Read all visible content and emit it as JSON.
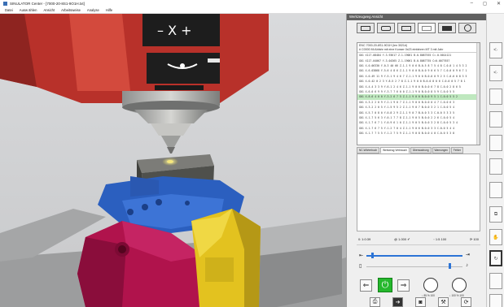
{
  "window": {
    "title": "SINULATOR Center - [7000-20-8S1-9O1H.txt]",
    "controls": [
      "–",
      "◻",
      "✕"
    ]
  },
  "menu": [
    "Datei",
    "Ausw ählen",
    "Ansicht",
    "Arbeitsweise",
    "Analyse",
    "Hilfe"
  ],
  "panel": {
    "header": "Werkzeugweg Ansicht",
    "toolbar_icons": [
      "pane-icon",
      "measure-icon",
      "stock-icon",
      "blank-icon",
      "machine-icon",
      "settings-icon"
    ],
    "nc_header": [
      "ENC 7000-20-8S1-9O1H (len 3021#)",
      "# C0000 Mi Abfahr mit eine Konser 0x23 einfahren MT 3 mit Jahr"
    ],
    "nc_lines": [
      "G01 X117.08484 Y-3.93617 Z-1.19061 B-0.8087555 C=-0.0014121",
      "G01 X117.04067 Y-3.04365 Z-1.19061 B-0.8087755 C=0.0077657",
      "G01 X-0.06330 Y-0.3 40 66 Z-1.1 9 0 6 B-0.5 8 7 5 4 8 C-0.0 1 4 5 3 2",
      "G01 X-6.03868 Y-5.6 4 8 6 Z-1.1 9 0 0 B-0.0 9 0 6 5 7 C-0.0 0 9 6 7 1",
      "G01 X-0.49 11 9 Y-5.1 9 4 6 7 Z-1.1 9 0 0 B-0.0 0 9 2 5 C-0.0 0 8 3 5",
      "G01 X-0.42 0 2 3 Y-8.5 2 7 8 Z-1.1 9 0 0 B-0.0 8 0 6 C-0.0 0 5 7 8 1",
      "G01 X-4.4 3 3 9 Y-6.1 2 4 6 Z-1.1 9 0 0 B-0.0 6 7 8 C-0.0 2 8 6 5",
      "G01 X-6.0 6 9 9 Y-3.7 7 6 0 0 Z-1.1 9 0 B-0.0 8 5 9 C-0.0 5 5",
      "G01 X-8.6 4 0 0 Y-3.2 6 7 5 Z-1.1 9 0 0 B-0.0 9 5 1 C-0.0 5 5 2",
      "G01 X-3.2 2 0 9 Y-2.1 9 0 7 Z-1.1 9 0 0 B-0.0 0 4 7 C-0.0 6 3",
      "G01 X-3.2 2 0 5 Y-1.5 9 5 2 Z-1.1 9 0 7 B-0.0 3 2 1 C-0.0 5 4",
      "G01 X-5.7 0 8 0 Y-0.8 2 9 Z-1.1 9 0 7 B-0.0 3 3 C-0.0 5 3 3 5",
      "G01 X-1.7 5 6 3 Y-0.1 7 7 8 Z-1.1 9 0 5 B-0.0 2 2 6 C-0.0 5 4",
      "G01 X-1.7 6 7 1 Y-0.9 6 1 0 Z-1.1 9 0 5 B-0.0 3 2 8 C-0.0 5 3 4",
      "G01 X-1.7 6 7 5 Y-1.2 7 0 4 Z-1.1 9 0 6 B-0.0 3 3 C-0.0 5 4 4",
      "G01 X-1.7 7 5 5 Y-1.2 7 5 9 Z-1.1 9 0 8 B-0.0 4 0 C-0.0 5 3 8"
    ],
    "current_line_index": 8,
    "subtabs": [
      "NC-Wörterbuch",
      "Werkzeug Verbrauch",
      "Überwachung",
      "Warnungen",
      "Fehler"
    ],
    "active_subtab_index": 1,
    "status": {
      "time": "0: 1:0:39",
      "feed": "@ 1.000 ✔",
      "mm": "◦ 1:5 100",
      "speed": "⟳ 100"
    },
    "gauges": [
      {
        "label": "↓ 85 % 100"
      },
      {
        "label": "↓ 100 % 100"
      }
    ],
    "bottom_icons": [
      "report-icon",
      "export-icon",
      "camera-icon",
      "tool-icon",
      "cycle-icon"
    ]
  },
  "rightcol_icons": [
    "back-icon",
    "cut-icon",
    "blank-icon",
    "blank-icon",
    "blank-icon",
    "blank-icon",
    "blank-icon",
    "stack-icon",
    "hand-icon",
    "return-icon",
    "blank-icon",
    "blank-icon"
  ],
  "colors": {
    "spindle_red": "#c0392b",
    "vise_blue": "#2b5fbf",
    "vise_yellow": "#e3c21f",
    "vise_magenta": "#b0134c",
    "nc_highlight": "#bfe8bf",
    "start_green": "#25b82d"
  }
}
